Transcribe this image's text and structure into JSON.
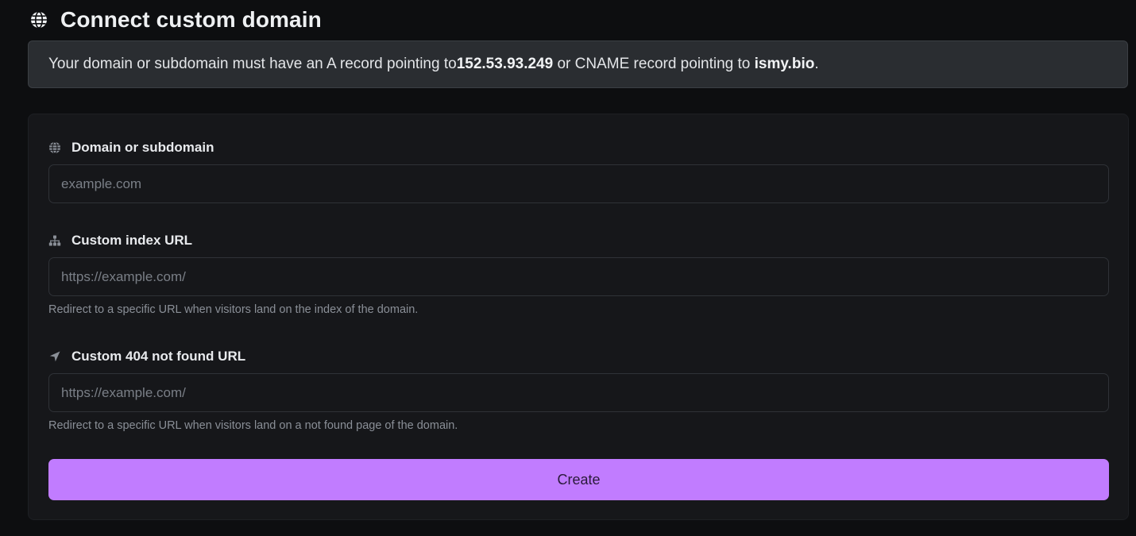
{
  "header": {
    "title": "Connect custom domain",
    "icon": "globe-icon"
  },
  "alert": {
    "prefix": "Your domain or subdomain must have an A record pointing to ",
    "ip": "152.53.93.249",
    "middle": " or CNAME record pointing to ",
    "cname": "ismy.bio",
    "suffix": "."
  },
  "form": {
    "domain": {
      "label": "Domain or subdomain",
      "icon": "globe-icon",
      "value": "",
      "placeholder": "example.com"
    },
    "index_url": {
      "label": "Custom index URL",
      "icon": "sitemap-icon",
      "value": "",
      "placeholder": "https://example.com/",
      "help": "Redirect to a specific URL when visitors land on the index of the domain."
    },
    "not_found_url": {
      "label": "Custom 404 not found URL",
      "icon": "location-arrow-icon",
      "value": "",
      "placeholder": "https://example.com/",
      "help": "Redirect to a specific URL when visitors land on a not found page of the domain."
    },
    "submit_label": "Create"
  },
  "colors": {
    "background": "#0d0e10",
    "alert_bg": "#2a2d31",
    "card_bg": "#16171a",
    "accent": "#c17cff"
  }
}
